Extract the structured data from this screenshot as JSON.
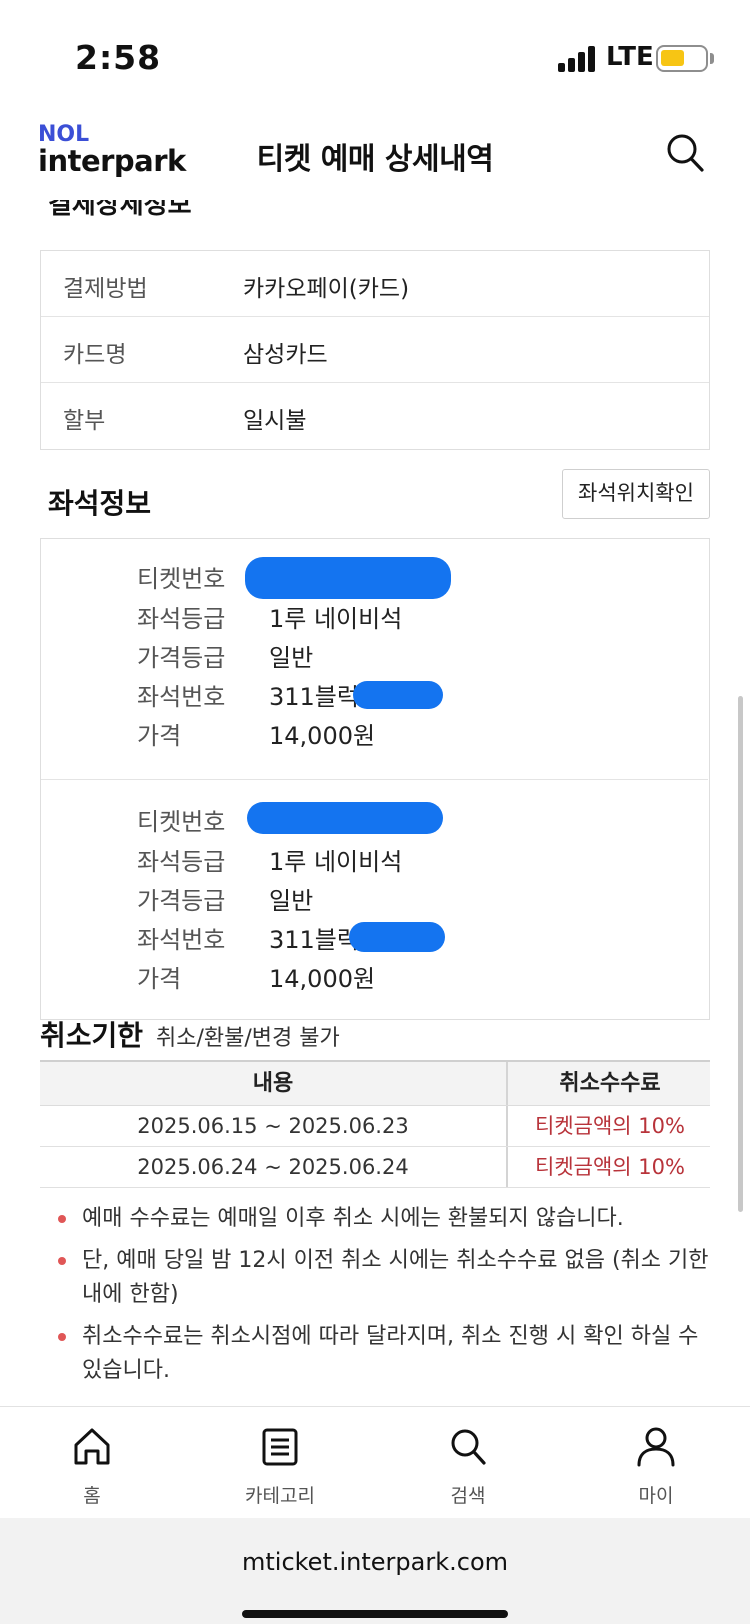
{
  "status_bar": {
    "time": "2:58",
    "network": "LTE",
    "battery_level": 0.55
  },
  "header": {
    "logo_top": "NOL",
    "logo_bottom": "interpark",
    "title": "티켓 예매 상세내역"
  },
  "payment": {
    "section_title": "결제상세정보",
    "rows": [
      {
        "label": "결제방법",
        "value": "카카오페이(카드)"
      },
      {
        "label": "카드명",
        "value": "삼성카드"
      },
      {
        "label": "할부",
        "value": "일시불"
      }
    ]
  },
  "seat": {
    "section_title": "좌석정보",
    "check_button": "좌석위치확인",
    "tickets": [
      {
        "ticket_no_label": "티켓번호",
        "grade_label": "좌석등급",
        "grade": "1루 네이비석",
        "price_grade_label": "가격등급",
        "price_grade": "일반",
        "seat_no_label": "좌석번호",
        "seat_no": "311블럭",
        "price_label": "가격",
        "price": "14,000원"
      },
      {
        "ticket_no_label": "티켓번호",
        "grade_label": "좌석등급",
        "grade": "1루 네이비석",
        "price_grade_label": "가격등급",
        "price_grade": "일반",
        "seat_no_label": "좌석번호",
        "seat_no": "311블럭",
        "price_label": "가격",
        "price": "14,000원"
      }
    ]
  },
  "cancel": {
    "title": "취소기한",
    "subtitle": "취소/환불/변경 불가",
    "headers": [
      "내용",
      "취소수수료"
    ],
    "rows": [
      {
        "period": "2025.06.15 ~ 2025.06.23",
        "fee": "티켓금액의 10%"
      },
      {
        "period": "2025.06.24 ~ 2025.06.24",
        "fee": "티켓금액의 10%"
      }
    ],
    "notes": [
      "예매 수수료는 예매일 이후 취소 시에는 환불되지 않습니다.",
      "단, 예매 당일 밤 12시 이전 취소 시에는 취소수수료 없음 (취소 기한 내에 한함)",
      "취소수수료는 취소시점에 따라 달라지며, 취소 진행 시 확인 하실 수 있습니다."
    ]
  },
  "bottom_nav": {
    "items": [
      {
        "label": "홈",
        "icon": "home-icon"
      },
      {
        "label": "카테고리",
        "icon": "category-icon"
      },
      {
        "label": "검색",
        "icon": "search-icon"
      },
      {
        "label": "마이",
        "icon": "person-icon"
      }
    ]
  },
  "browser": {
    "url": "mticket.interpark.com"
  },
  "colors": {
    "brand": "#3b4fd6",
    "fee_red": "#b8333a",
    "mask_blue": "#1474f0",
    "bullet": "#e05656"
  }
}
